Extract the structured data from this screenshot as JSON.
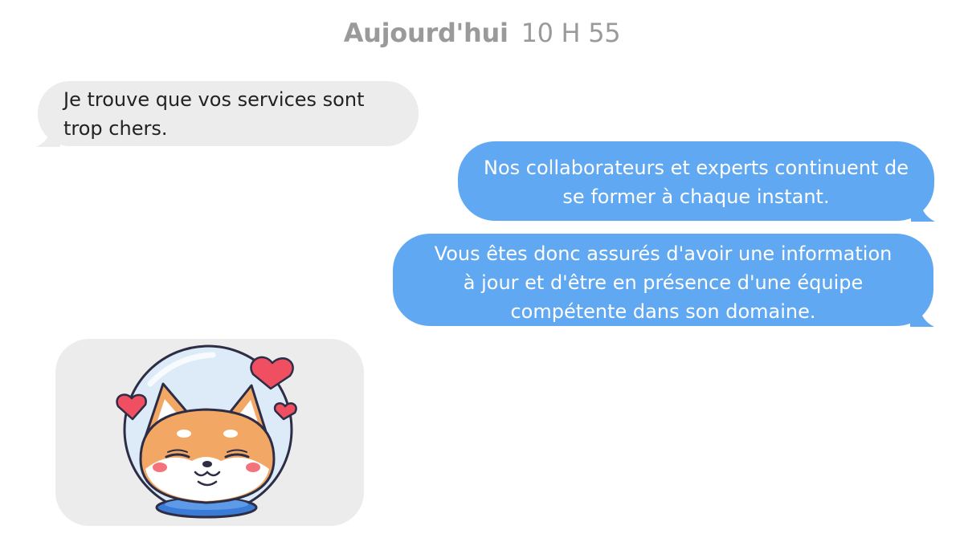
{
  "header": {
    "day": "Aujourd'hui",
    "time": "10 H 55"
  },
  "messages": [
    {
      "direction": "incoming",
      "lines": [
        "Je trouve que vos services sont",
        "trop chers."
      ]
    },
    {
      "direction": "outgoing",
      "lines": [
        "Nos collaborateurs et experts continuent de",
        "se former à chaque instant."
      ]
    },
    {
      "direction": "outgoing",
      "lines": [
        "Vous êtes donc assurés d'avoir une information",
        "à jour et d'être en présence d'une équipe",
        "compétente dans son domaine."
      ]
    }
  ],
  "sticker": {
    "icon": "shiba-astronaut-hearts-sticker"
  },
  "colors": {
    "incoming_bubble": "#ececec",
    "outgoing_bubble": "#60a8f1",
    "header_text": "#9a9a9a"
  }
}
